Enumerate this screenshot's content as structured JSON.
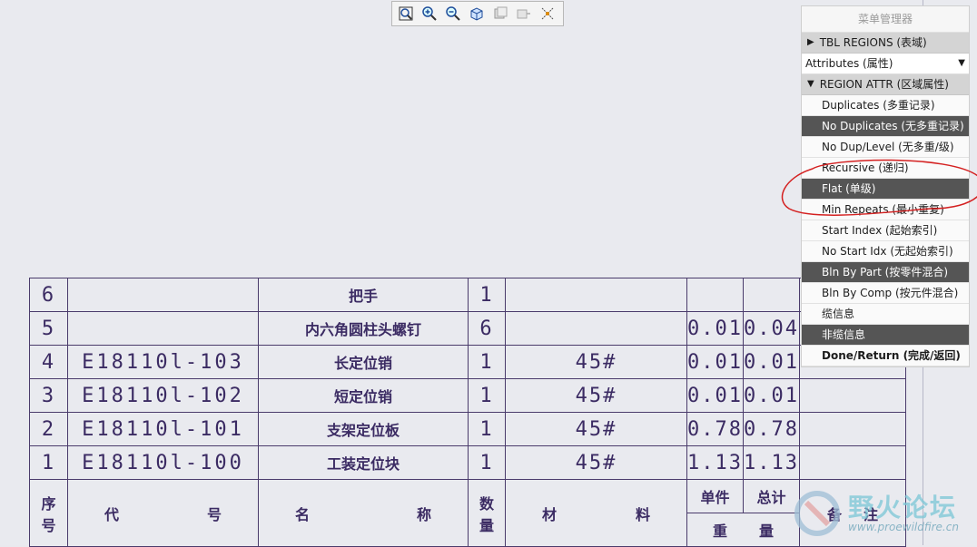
{
  "toolbar": {
    "icons": [
      "zoom-fit-icon",
      "zoom-in-icon",
      "zoom-out-icon",
      "view-3d-icon",
      "view-layer-icon",
      "view-shift-icon",
      "display-style-icon"
    ]
  },
  "table": {
    "rows": [
      {
        "no": "6",
        "code": "",
        "name": "把手",
        "qty": "1",
        "material": "",
        "unit": "",
        "total": ""
      },
      {
        "no": "5",
        "code": "",
        "name": "内六角圆柱头螺钉",
        "qty": "6",
        "material": "",
        "unit": "0.01",
        "total": "0.04"
      },
      {
        "no": "4",
        "code": "E18110l-103",
        "name": "长定位销",
        "qty": "1",
        "material": "45#",
        "unit": "0.01",
        "total": "0.01"
      },
      {
        "no": "3",
        "code": "E18110l-102",
        "name": "短定位销",
        "qty": "1",
        "material": "45#",
        "unit": "0.01",
        "total": "0.01"
      },
      {
        "no": "2",
        "code": "E18110l-101",
        "name": "支架定位板",
        "qty": "1",
        "material": "45#",
        "unit": "0.78",
        "total": "0.78"
      },
      {
        "no": "1",
        "code": "E18110l-100",
        "name": "工装定位块",
        "qty": "1",
        "material": "45#",
        "unit": "1.13",
        "total": "1.13"
      }
    ],
    "header": {
      "no_a": "序",
      "no_b": "号",
      "code_a": "代",
      "code_b": "号",
      "name_a": "名",
      "name_b": "称",
      "qty_a": "数",
      "qty_b": "量",
      "mat_a": "材",
      "mat_b": "料",
      "unit": "单件",
      "total": "总计",
      "weight_a": "重",
      "weight_b": "量",
      "remark_a": "备",
      "remark_b": "注"
    }
  },
  "menu": {
    "title": "菜单管理器",
    "section1": "TBL REGIONS (表域)",
    "dropdown": "Attributes (属性)",
    "section2": "REGION ATTR (区域属性)",
    "items": [
      {
        "label": "Duplicates (多重记录)",
        "selected": false
      },
      {
        "label": "No Duplicates (无多重记录)",
        "selected": true
      },
      {
        "label": "No Dup/Level (无多重/级)",
        "selected": false
      },
      {
        "label": "Recursive (递归)",
        "selected": false
      },
      {
        "label": "Flat (单级)",
        "selected": true
      },
      {
        "label": "Min Repeats (最小重复)",
        "selected": false
      },
      {
        "label": "Start Index (起始索引)",
        "selected": false
      },
      {
        "label": "No Start Idx (无起始索引)",
        "selected": false
      },
      {
        "label": "Bln By Part (按零件混合)",
        "selected": true
      },
      {
        "label": "Bln By Comp (按元件混合)",
        "selected": false
      },
      {
        "label": "缆信息",
        "selected": false
      },
      {
        "label": "非缆信息",
        "selected": true
      },
      {
        "label": "Done/Return (完成/返回)",
        "selected": false,
        "bold": true
      }
    ]
  },
  "watermark": {
    "title": "野火论坛",
    "url": "www.proewildfire.cn"
  }
}
